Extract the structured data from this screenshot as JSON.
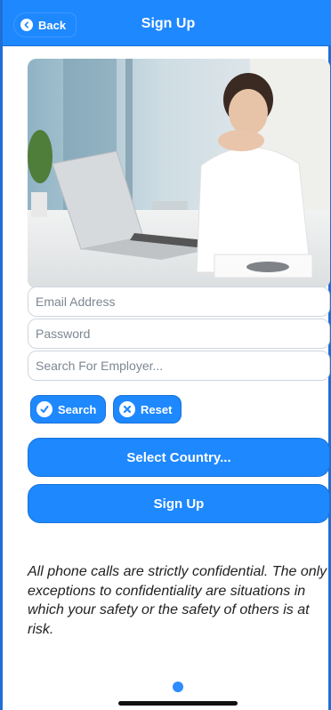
{
  "header": {
    "back_label": "Back",
    "title": "Sign Up"
  },
  "form": {
    "email_placeholder": "Email Address",
    "password_placeholder": "Password",
    "employer_placeholder": "Search For Employer...",
    "search_label": "Search",
    "reset_label": "Reset",
    "country_label": "Select Country...",
    "signup_label": "Sign Up"
  },
  "note": "All phone calls are strictly confidential. The only exceptions to confidentiality are situations in which your safety or the safety of others is at risk.",
  "colors": {
    "accent": "#1e88ff",
    "border": "#1f6fd6"
  },
  "icons": {
    "back": "chevron-left-icon",
    "search": "checkmark-icon",
    "reset": "x-icon"
  }
}
